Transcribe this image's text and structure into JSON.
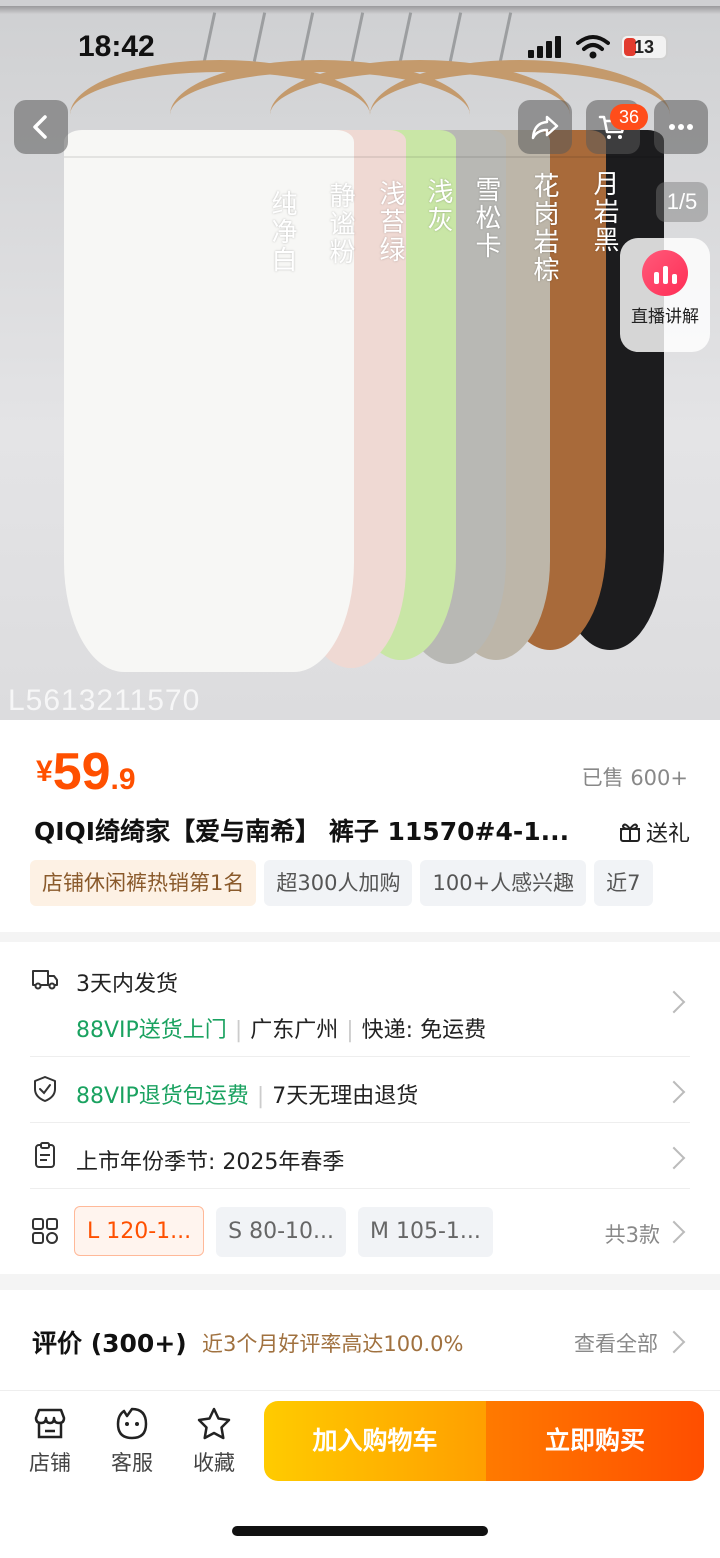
{
  "status_bar": {
    "time": "18:42",
    "battery": "13"
  },
  "hero": {
    "cart_badge": "36",
    "page_indicator": "1/5",
    "live_label": "直播讲解",
    "watermark": "L5613211570",
    "color_labels": [
      "纯净白",
      "静谧粉",
      "浅苔绿",
      "浅灰",
      "雪松卡",
      "花岗岩棕",
      "月岩黑"
    ],
    "pant_colors": [
      "#f7f7f5",
      "#efd9d3",
      "#c9e6a6",
      "#b8b8b4",
      "#bdb6a9",
      "#a86a3a",
      "#1c1c1e"
    ]
  },
  "product": {
    "currency": "¥",
    "price_int": "59",
    "price_dec": ".9",
    "sold": "已售 600+",
    "title": "QIQI绮绮家【爱与南希】 裤子 11570#4-1...",
    "gift_label": "送礼",
    "tags": [
      "店铺休闲裤热销第1名",
      "超300人加购",
      "100+人感兴趣",
      "近7"
    ]
  },
  "service": {
    "shipping_time": "3天内发货",
    "vip_delivery": "88VIP送货上门",
    "location": "广东广州",
    "express": "快递: 免运费",
    "vip_return": "88VIP退货包运费",
    "return_policy": "7天无理由退货",
    "season": "上市年份季节: 2025年春季",
    "skus": [
      "L 120-1...",
      "S 80-10...",
      "M 105-1..."
    ],
    "sku_count": "共3款"
  },
  "review": {
    "title": "评价 (300+)",
    "rate": "近3个月好评率高达100.0%",
    "view_all": "查看全部"
  },
  "bottom_bar": {
    "shop": "店铺",
    "service": "客服",
    "favorite": "收藏",
    "add_cart": "加入购物车",
    "buy_now": "立即购买"
  }
}
